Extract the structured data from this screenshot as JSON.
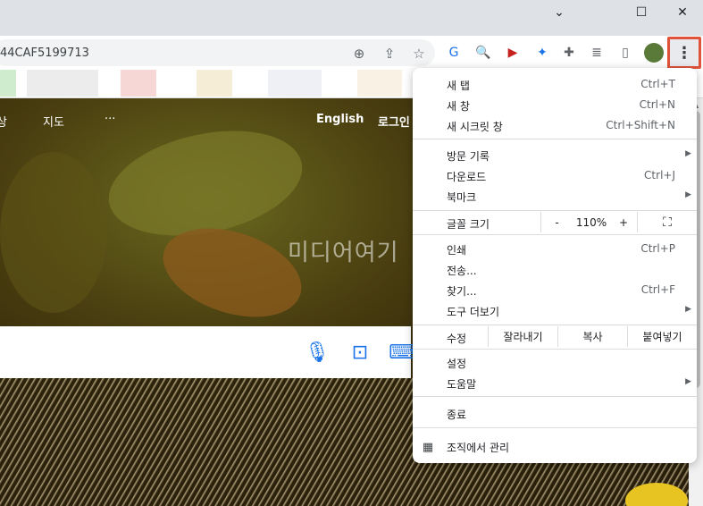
{
  "window": {
    "minimize_icon": "chevron-down",
    "buttons": [
      "–",
      "☐",
      "✕"
    ],
    "tab_search_glyph": "⌄"
  },
  "toolbar": {
    "url": "44CAF5199713",
    "icons": [
      "zoom-icon",
      "share-icon",
      "bookmark-star-icon"
    ],
    "extensions": [
      "translate-icon",
      "search-ext-icon",
      "media-ext-icon",
      "sparkle-icon",
      "puzzle-icon",
      "playlist-icon",
      "sidepanel-icon",
      "profile-avatar"
    ],
    "menu_glyph": "⋮"
  },
  "page": {
    "nav": [
      "지도",
      "···",
      "English",
      "로그인"
    ],
    "nav_cut_left": "상",
    "hero_text": "미디어여기",
    "search_icons": [
      "mic-icon",
      "lens-icon",
      "keyboard-icon"
    ]
  },
  "menu": {
    "new_tab": {
      "label": "새 탭",
      "shortcut": "Ctrl+T"
    },
    "new_window": {
      "label": "새 창",
      "shortcut": "Ctrl+N"
    },
    "incognito": {
      "label": "새 시크릿 창",
      "shortcut": "Ctrl+Shift+N"
    },
    "history": {
      "label": "방문 기록"
    },
    "downloads": {
      "label": "다운로드",
      "shortcut": "Ctrl+J"
    },
    "bookmarks": {
      "label": "북마크"
    },
    "zoom": {
      "label": "글꼴 크기",
      "minus": "-",
      "value": "110%",
      "plus": "+",
      "fullscreen": "⛶"
    },
    "print": {
      "label": "인쇄",
      "shortcut": "Ctrl+P"
    },
    "cast": {
      "label": "전송..."
    },
    "find": {
      "label": "찾기...",
      "shortcut": "Ctrl+F"
    },
    "more_tools": {
      "label": "도구 더보기"
    },
    "edit": {
      "label": "수정",
      "cut": "잘라내기",
      "copy": "복사",
      "paste": "붙여넣기"
    },
    "settings": {
      "label": "설정"
    },
    "help": {
      "label": "도움말"
    },
    "exit": {
      "label": "종료"
    },
    "managed": {
      "label": "조직에서 관리"
    }
  }
}
